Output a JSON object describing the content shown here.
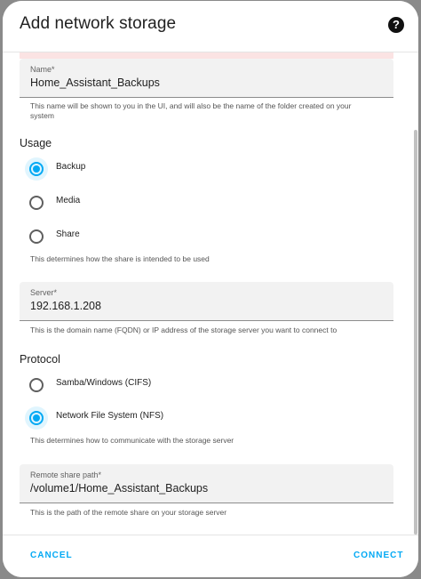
{
  "dialog": {
    "title": "Add network storage",
    "help_icon": "help-circle-icon"
  },
  "name_field": {
    "label": "Name*",
    "value": "Home_Assistant_Backups",
    "helper": "This name will be shown to you in the UI, and will also be the name of the folder created on your system"
  },
  "usage": {
    "title": "Usage",
    "options": [
      {
        "label": "Backup",
        "checked": true
      },
      {
        "label": "Media",
        "checked": false
      },
      {
        "label": "Share",
        "checked": false
      }
    ],
    "helper": "This determines how the share is intended to be used"
  },
  "server_field": {
    "label": "Server*",
    "value": "192.168.1.208",
    "helper": "This is the domain name (FQDN) or IP address of the storage server you want to connect to"
  },
  "protocol": {
    "title": "Protocol",
    "options": [
      {
        "label": "Samba/Windows (CIFS)",
        "checked": false
      },
      {
        "label": "Network File System (NFS)",
        "checked": true
      }
    ],
    "helper": "This determines how to communicate with the storage server"
  },
  "path_field": {
    "label": "Remote share path*",
    "value": "/volume1/Home_Assistant_Backups",
    "helper": "This is the path of the remote share on your storage server"
  },
  "footer": {
    "cancel_label": "CANCEL",
    "connect_label": "CONNECT"
  },
  "colors": {
    "accent": "#03a9f4",
    "error_tint": "#fbe3e3"
  }
}
